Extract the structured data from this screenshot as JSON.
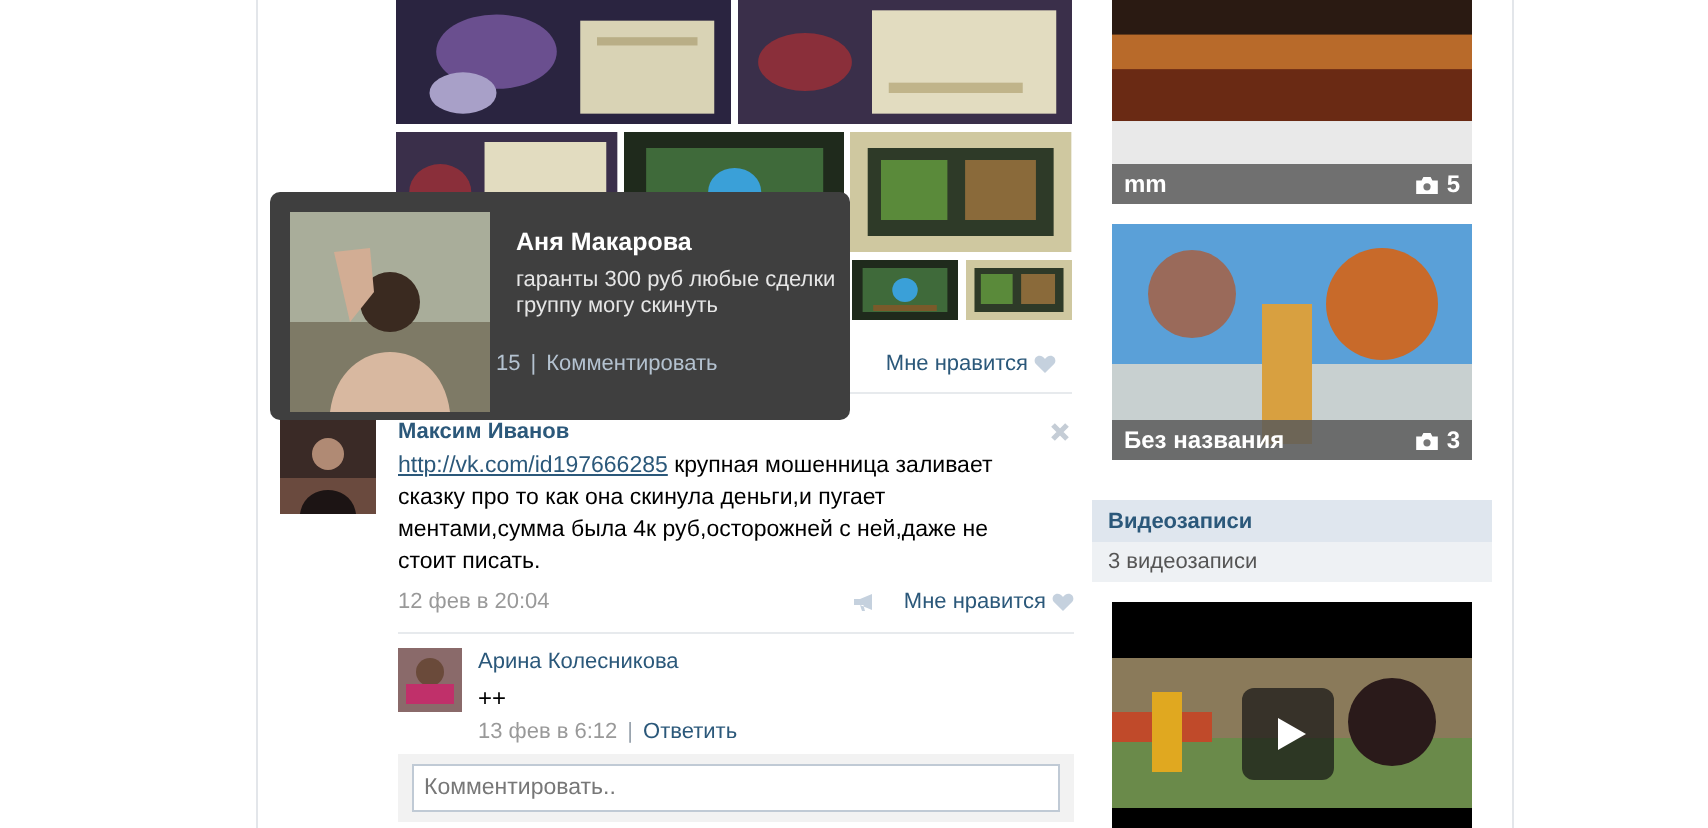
{
  "post": {
    "time": "15",
    "separator": "|",
    "comment_link": "Комментировать",
    "like": "Мне нравится"
  },
  "profile_popup": {
    "name": "Аня Макарова",
    "status": "гаранты 300 руб любые сделки группу могу скинуть"
  },
  "comment": {
    "author": "Максим Иванов",
    "link": "http://vk.com/id197666285",
    "text": " крупная мошенница заливает сказку про то как она скинула деньги,и пугает ментами,сумма была 4к руб,осторожней с ней,даже не стоит писать.",
    "date": "12 фев в 20:04",
    "like": "Мне нравится"
  },
  "reply": {
    "author": "Арина Колесникова",
    "text": "++",
    "date": "13 фев в 6:12",
    "separator": "|",
    "reply_link": "Ответить"
  },
  "comment_field": {
    "placeholder": "Комментировать.."
  },
  "albums": [
    {
      "title": "mm",
      "count": "5"
    },
    {
      "title": "Без названия",
      "count": "3"
    }
  ],
  "videos": {
    "title": "Видеозаписи",
    "count": "3 видеозаписи"
  }
}
